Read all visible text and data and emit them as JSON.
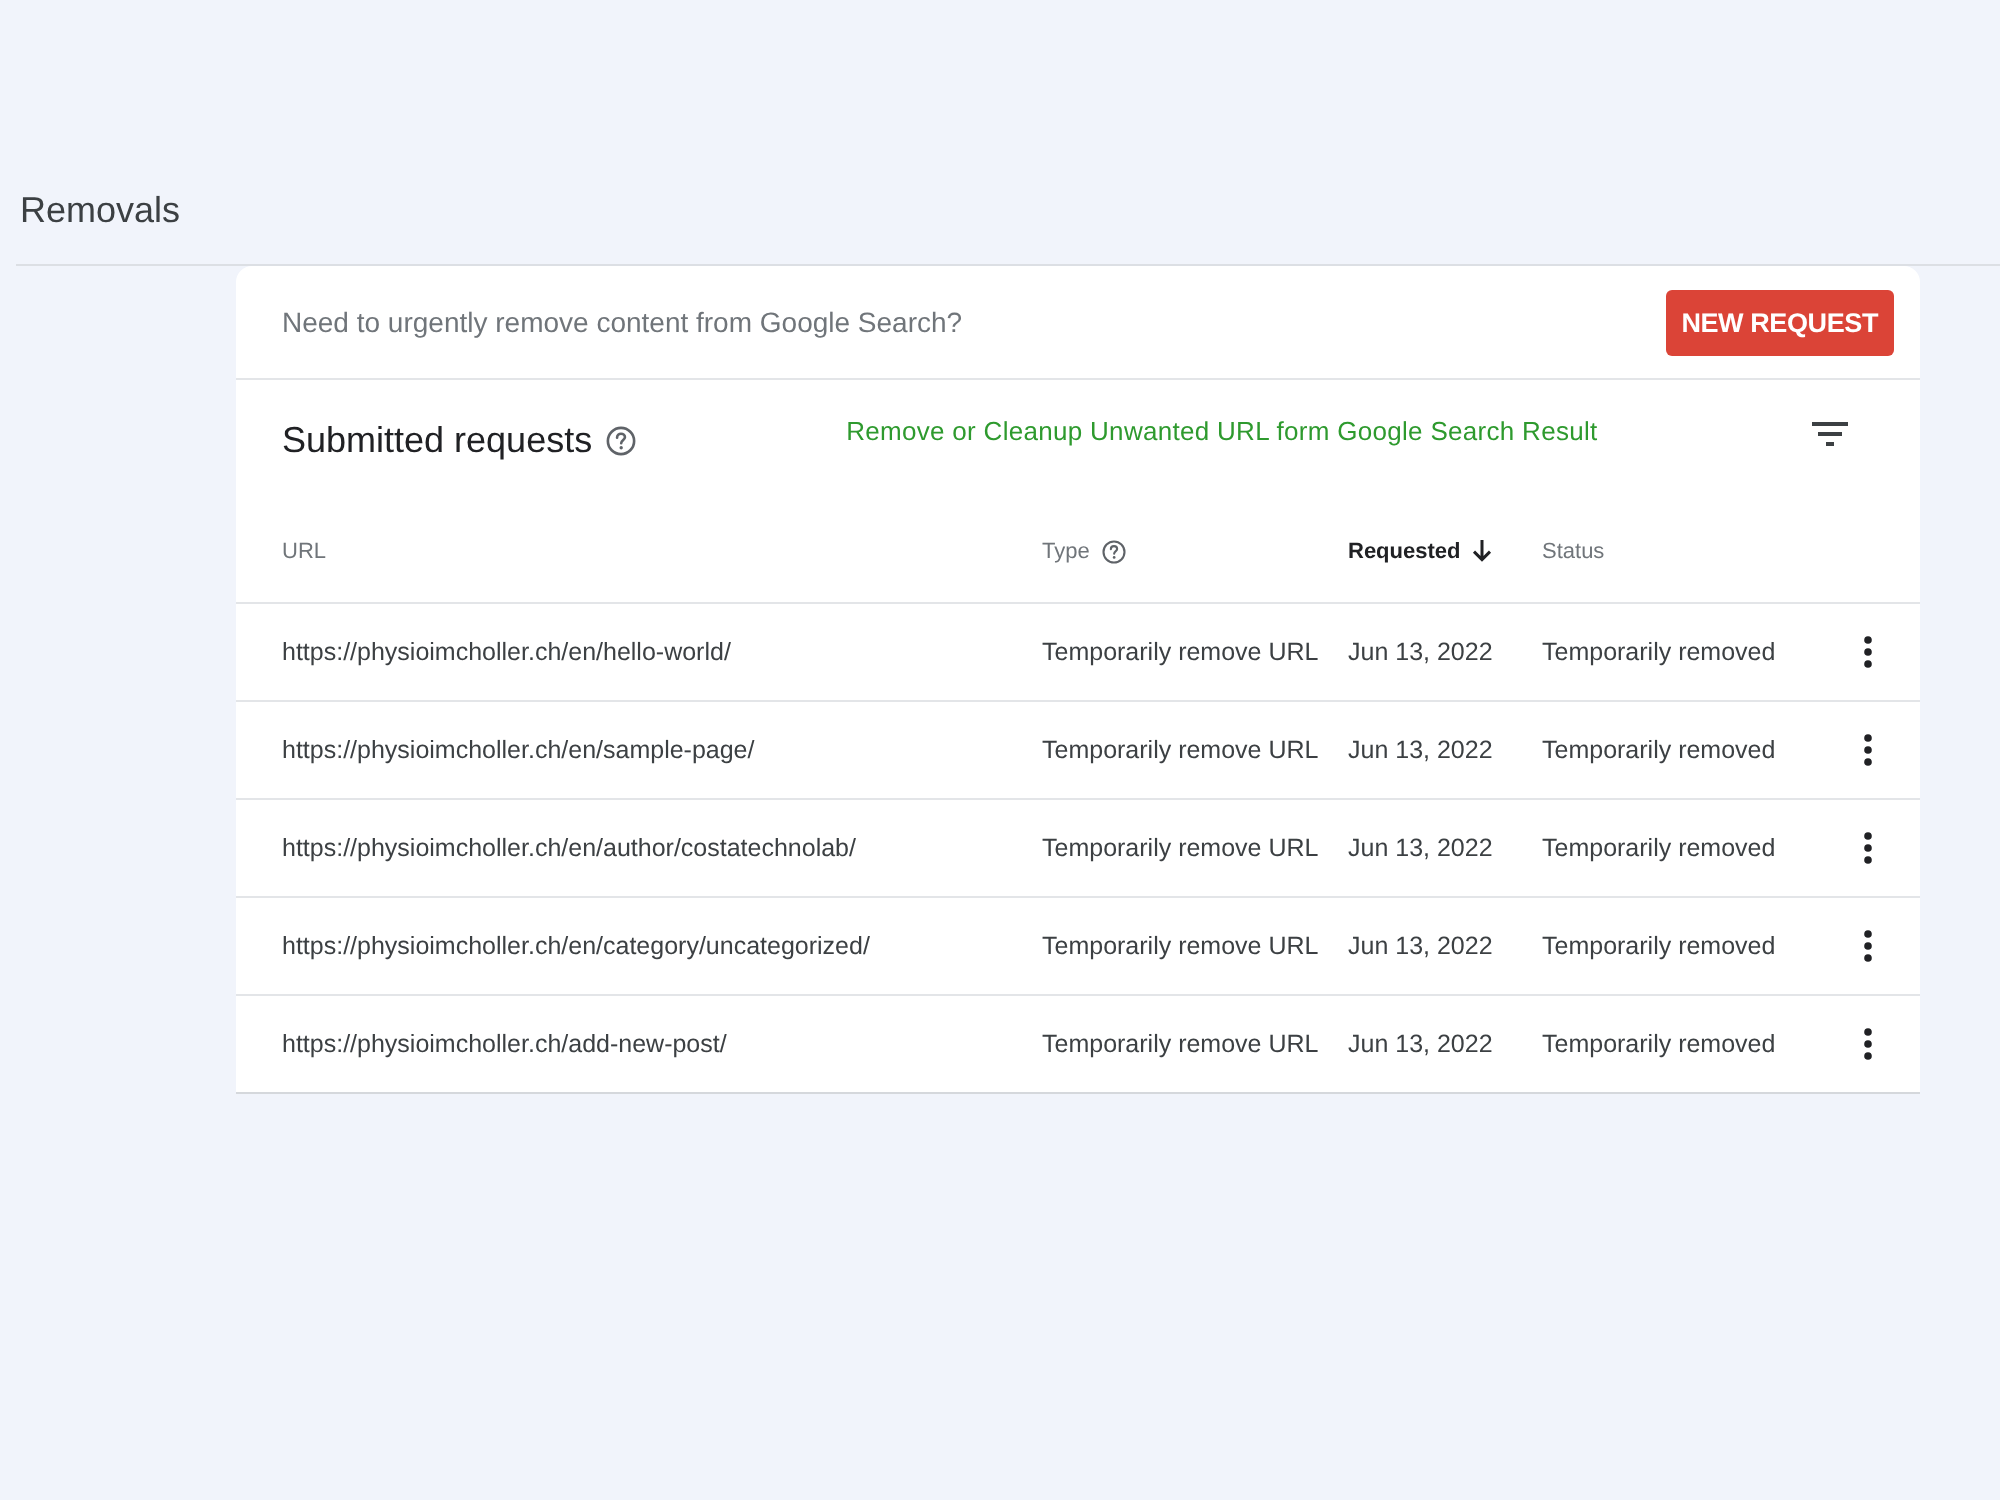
{
  "page": {
    "title": "Removals"
  },
  "banner": {
    "text": "Need to urgently remove content from Google Search?",
    "button": "NEW REQUEST"
  },
  "panel": {
    "title": "Submitted requests",
    "annotation": "Remove or Cleanup Unwanted URL form Google Search Result"
  },
  "table": {
    "columns": [
      {
        "label": "URL",
        "help": false,
        "sorted": false
      },
      {
        "label": "Type",
        "help": true,
        "sorted": false
      },
      {
        "label": "Requested",
        "help": false,
        "sorted": true
      },
      {
        "label": "Status",
        "help": false,
        "sorted": false
      }
    ],
    "rows": [
      {
        "cells": [
          "https://physioimcholler.ch/en/hello-world/",
          "Temporarily remove URL",
          "Jun 13, 2022",
          "Temporarily removed"
        ]
      },
      {
        "cells": [
          "https://physioimcholler.ch/en/sample-page/",
          "Temporarily remove URL",
          "Jun 13, 2022",
          "Temporarily removed"
        ]
      },
      {
        "cells": [
          "https://physioimcholler.ch/en/author/costatechnolab/",
          "Temporarily remove URL",
          "Jun 13, 2022",
          "Temporarily removed"
        ]
      },
      {
        "cells": [
          "https://physioimcholler.ch/en/category/uncategorized/",
          "Temporarily remove URL",
          "Jun 13, 2022",
          "Temporarily removed"
        ]
      },
      {
        "cells": [
          "https://physioimcholler.ch/add-new-post/",
          "Temporarily remove URL",
          "Jun 13, 2022",
          "Temporarily removed"
        ]
      }
    ]
  }
}
